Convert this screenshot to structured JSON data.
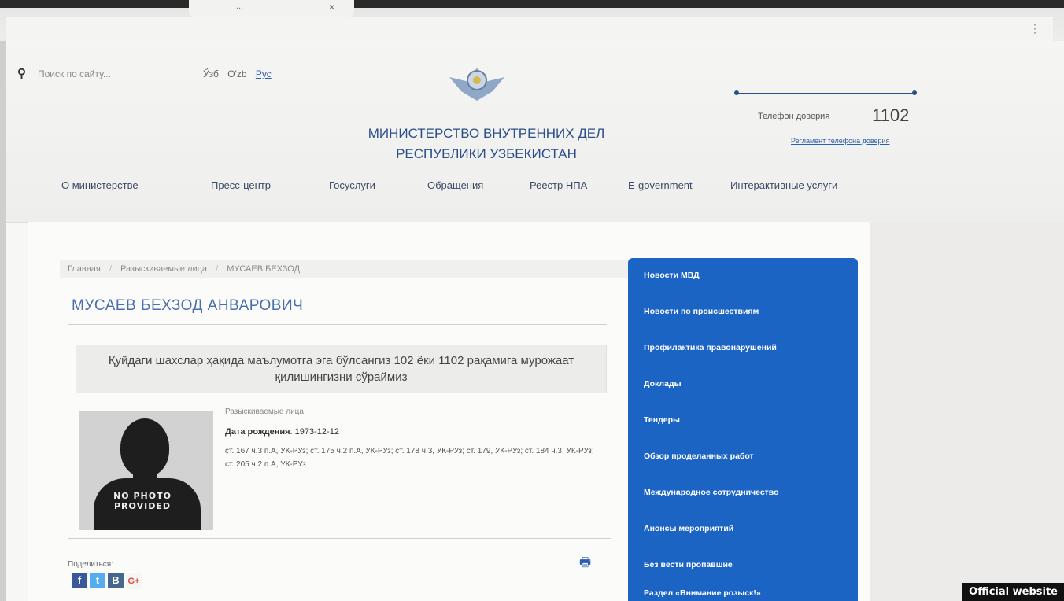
{
  "browser": {
    "tab_title": "...",
    "tab_close": "×",
    "menu_dots": "⋮"
  },
  "header": {
    "search_icon": "search-icon",
    "search_placeholder": "Поиск по сайту...",
    "languages": [
      "Ўзб",
      "O'zb",
      "Рус"
    ],
    "active_language": "Рус",
    "ministry_line1": "МИНИСТЕРСТВО ВНУТРЕННИХ ДЕЛ",
    "ministry_line2": "РЕСПУБЛИКИ УЗБЕКИСТАН",
    "hotline_label": "Телефон доверия",
    "hotline_number": "1102",
    "hotline_regulation": "Регламент телефона доверия"
  },
  "nav": [
    "О министерстве",
    "Пресс-центр",
    "Госуслуги",
    "Обращения",
    "Реестр НПА",
    "E-government",
    "Интерактивные услуги"
  ],
  "breadcrumb": [
    "Главная",
    "Разыскиваемые лица",
    "МУСАЕВ БЕХЗОД"
  ],
  "breadcrumb_separator": "/",
  "person": {
    "name": "МУСАЕВ БЕХЗОД АНВАРОВИЧ",
    "notice": "Қуйдаги шахслар ҳақида маълумотга эга бўлсангиз 102 ёки 1102 рақамига мурожаат қилишингизни сўраймиз",
    "photo_placeholder_line1": "NO PHOTO",
    "photo_placeholder_line2": "PROVIDED",
    "category": "Разыскиваемые лица",
    "dob_label": "Дата рождения",
    "dob_value": "1973-12-12",
    "articles": "ст. 167 ч.3 п.А, УК-РУз; ст. 175 ч.2 п.А, УК-РУз; ст. 178 ч.3, УК-РУз; ст. 179, УК-РУз; ст. 184 ч.3, УК-РУз; ст. 205 ч.2 п.А, УК-РУз"
  },
  "share": {
    "label": "Поделиться:",
    "buttons": [
      "f",
      "t",
      "B",
      "G+"
    ]
  },
  "print_icon": "print-icon",
  "sidebar": [
    "Новости МВД",
    "Новости по происшествиям",
    "Профилактика правонарушений",
    "Доклады",
    "Тендеры",
    "Обзор проделанных работ",
    "Международное сотрудничество",
    "Анонсы мероприятий",
    "Без вести пропавшие",
    "Раздел «Внимание розыск!»"
  ],
  "watermark": "Official website",
  "colors": {
    "accent": "#1c64c4",
    "title": "#4a6fb0",
    "ministry": "#2b4f8a"
  }
}
